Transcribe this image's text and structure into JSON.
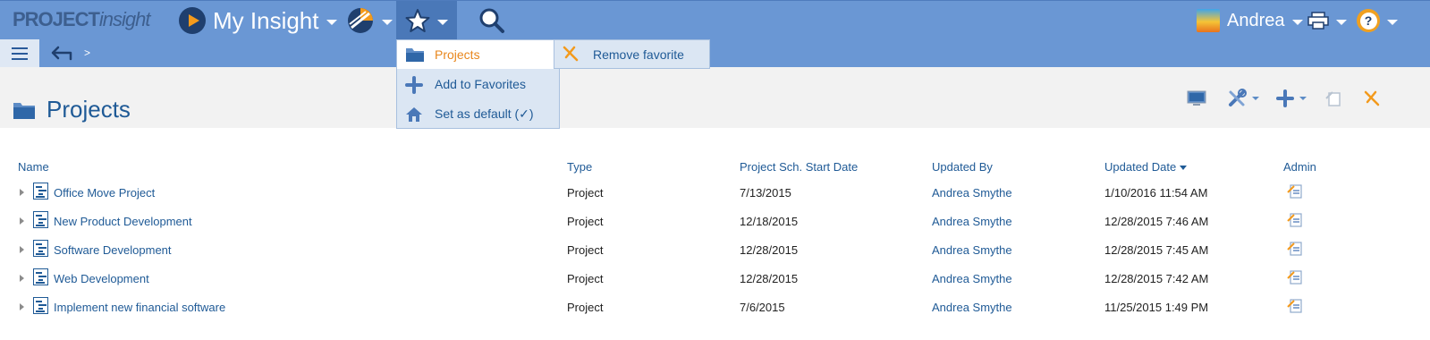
{
  "topbar": {
    "logo_bold": "PROJECT",
    "logo_light": "insight",
    "workspace_label": "My Insight",
    "user_name": "Andrea",
    "help_glyph": "?"
  },
  "subbar": {
    "breadcrumb_separator": ">"
  },
  "page": {
    "title": "Projects"
  },
  "favorites_menu": {
    "items": [
      {
        "label": "Projects",
        "icon": "folder-icon"
      },
      {
        "label": "Add to Favorites",
        "icon": "plus-icon"
      },
      {
        "label": "Set as default (✓)",
        "icon": "home-icon"
      }
    ],
    "submenu_label": "Remove favorite"
  },
  "table": {
    "columns": [
      "Name",
      "Type",
      "Project Sch. Start Date",
      "Updated By",
      "Updated Date",
      "Admin"
    ],
    "sorted_column": "Updated Date",
    "rows": [
      {
        "name": "Office Move Project",
        "type": "Project",
        "start": "7/13/2015",
        "updated_by": "Andrea Smythe",
        "updated": "1/10/2016 11:54 AM"
      },
      {
        "name": "New Product Development",
        "type": "Project",
        "start": "12/18/2015",
        "updated_by": "Andrea Smythe",
        "updated": "12/28/2015 7:46 AM"
      },
      {
        "name": "Software Development",
        "type": "Project",
        "start": "12/28/2015",
        "updated_by": "Andrea Smythe",
        "updated": "12/28/2015 7:45 AM"
      },
      {
        "name": "Web Development",
        "type": "Project",
        "start": "12/28/2015",
        "updated_by": "Andrea Smythe",
        "updated": "12/28/2015 7:42 AM"
      },
      {
        "name": "Implement new financial software",
        "type": "Project",
        "start": "7/6/2015",
        "updated_by": "Andrea Smythe",
        "updated": "11/25/2015 1:49 PM"
      }
    ]
  },
  "colors": {
    "topbar": "#6a97d4",
    "active_tab": "#4a78b8",
    "link": "#1f5a96",
    "accent_orange": "#e8861c",
    "menu_bg": "#dbe6f3"
  }
}
